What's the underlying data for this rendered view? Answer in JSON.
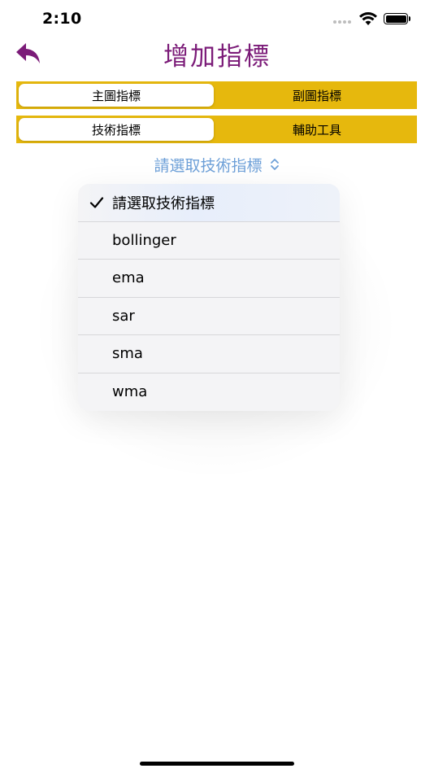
{
  "status_bar": {
    "time": "2:10"
  },
  "header": {
    "title": "增加指標",
    "back_icon": "back-arrow-icon"
  },
  "segments": {
    "chart_type": {
      "options": [
        "主圖指標",
        "副圖指標"
      ],
      "selected": "主圖指標"
    },
    "tool_type": {
      "options": [
        "技術指標",
        "輔助工具"
      ],
      "selected": "技術指標"
    }
  },
  "picker": {
    "label": "請選取技術指標",
    "icon": "chevron-up-down-icon",
    "color": "#6ea0d8"
  },
  "menu": {
    "items": [
      {
        "label": "請選取技術指標",
        "checked": true
      },
      {
        "label": "bollinger",
        "checked": false
      },
      {
        "label": "ema",
        "checked": false
      },
      {
        "label": "sar",
        "checked": false
      },
      {
        "label": "sma",
        "checked": false
      },
      {
        "label": "wma",
        "checked": false
      }
    ]
  },
  "colors": {
    "title": "#7b1b78",
    "segment_bg": "#e6b80d"
  }
}
